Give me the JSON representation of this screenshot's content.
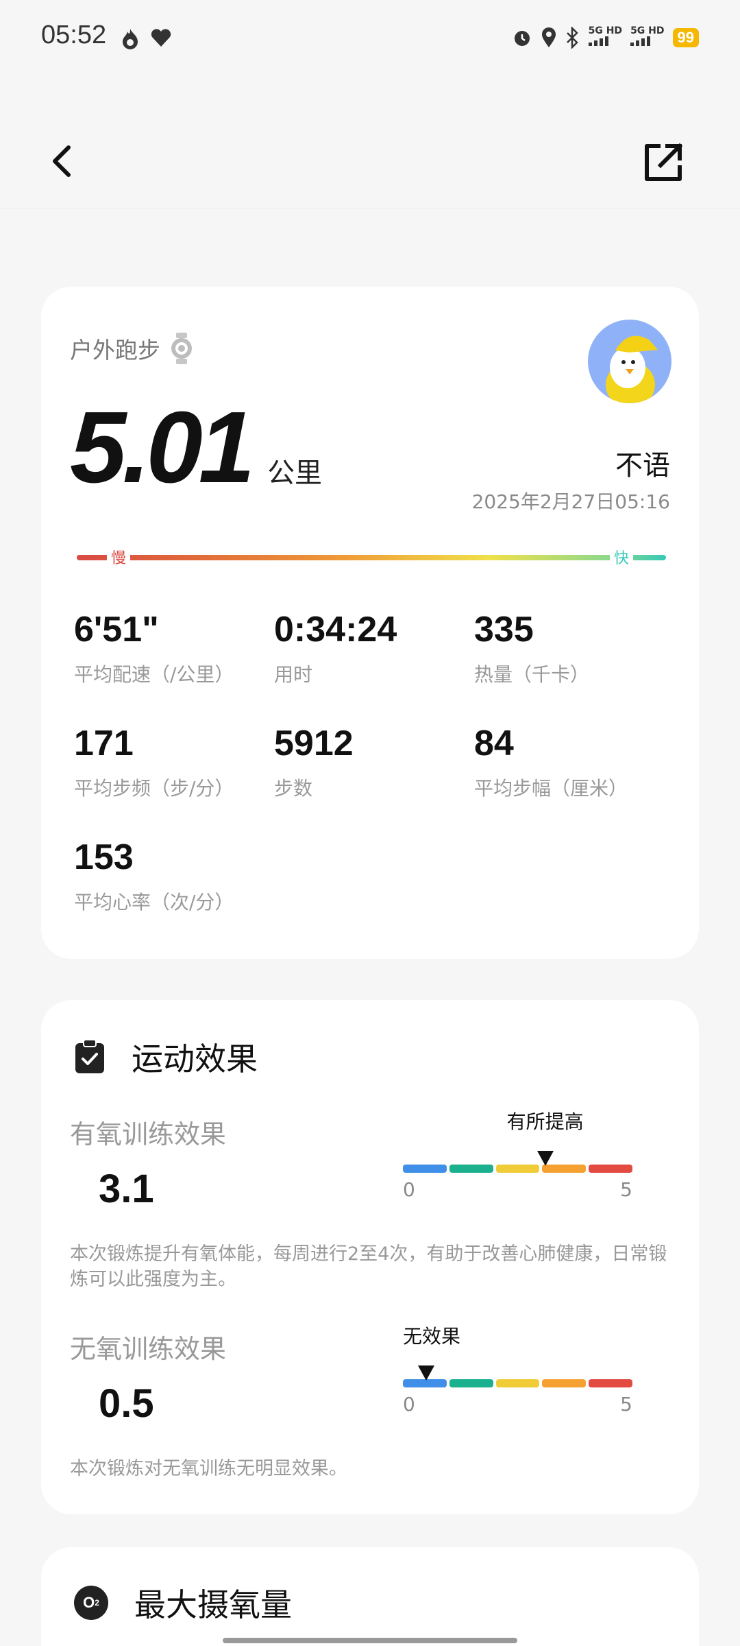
{
  "status_bar": {
    "time": "05:52",
    "left_icons": [
      "fire-icon",
      "heart-icon"
    ],
    "right_icons": [
      "alarm-icon",
      "location-icon",
      "bluetooth-icon"
    ],
    "sim1": "5G HD",
    "sim2": "5G HD",
    "battery": "99"
  },
  "nav": {
    "back_icon": "back-arrow-icon",
    "share_icon": "share-icon"
  },
  "summary": {
    "activity": "户外跑步",
    "device_icon": "watch-icon",
    "distance": "5.01",
    "distance_unit": "公里",
    "username": "不语",
    "datetime": "2025年2月27日05:16",
    "pace_slow": "慢",
    "pace_fast": "快",
    "metrics": [
      {
        "value": "6'51\"",
        "label": "平均配速（/公里）"
      },
      {
        "value": "0:34:24",
        "label": "用时"
      },
      {
        "value": "335",
        "label": "热量（千卡）"
      },
      {
        "value": "171",
        "label": "平均步频（步/分）"
      },
      {
        "value": "5912",
        "label": "步数"
      },
      {
        "value": "84",
        "label": "平均步幅（厘米）"
      },
      {
        "value": "153",
        "label": "平均心率（次/分）"
      }
    ]
  },
  "effect": {
    "title": "运动效果",
    "scale_colors": [
      "#3f8fe8",
      "#1bb08e",
      "#efcc38",
      "#f5a132",
      "#e34a41"
    ],
    "aerobic": {
      "label": "有氧训练效果",
      "value": "3.1",
      "level": "有所提高",
      "scale_min": "0",
      "scale_max": "5",
      "marker_value": 3.1,
      "description": "本次锻炼提升有氧体能，每周进行2至4次，有助于改善心肺健康，日常锻炼可以此强度为主。"
    },
    "anaerobic": {
      "label": "无氧训练效果",
      "value": "0.5",
      "level": "无效果",
      "scale_min": "0",
      "scale_max": "5",
      "marker_value": 0.5,
      "description": "本次锻炼对无氧训练无明显效果。"
    }
  },
  "vo2": {
    "title": "最大摄氧量",
    "icon_text": "O",
    "icon_sub": "2"
  }
}
